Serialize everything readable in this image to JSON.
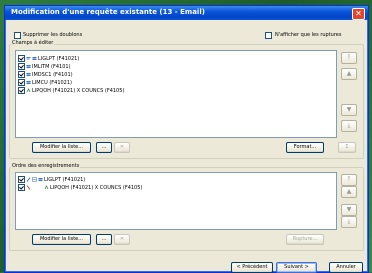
{
  "window": {
    "title": "Modification d'une requête existante (13 - Email)"
  },
  "options": {
    "remove_duplicates": "Supprimer les doublons",
    "show_breaks_only": "N'afficher que les ruptures"
  },
  "fields_group": {
    "label": "Champs à éditer",
    "items": [
      "LIGLPT (F41021)",
      "IMLITM (F4101)",
      "IMDSC1 (F4101)",
      "LIMCU (F41021)",
      "LIPQOH (F41021) X COUNCS (F4105)"
    ],
    "modify_button": "Modifier la liste...",
    "format_button": "Format..."
  },
  "order_group": {
    "label": "Ordre des enregistrements",
    "items": [
      "LIGLPT (F41021)",
      "LIPQOH (F41021) X COUNCS (F4105)"
    ],
    "modify_button": "Modifier la liste...",
    "breaks_button": "Rupture..."
  },
  "footer": {
    "previous": "< Précédent",
    "next": "Suivant >",
    "cancel": "Annuler"
  },
  "glyphs": {
    "up": "▲",
    "up_top": "⤒",
    "down": "▼",
    "down_bottom": "⤓",
    "dots": "...",
    "x": "✕",
    "sum": "Σ",
    "close": "✕"
  }
}
